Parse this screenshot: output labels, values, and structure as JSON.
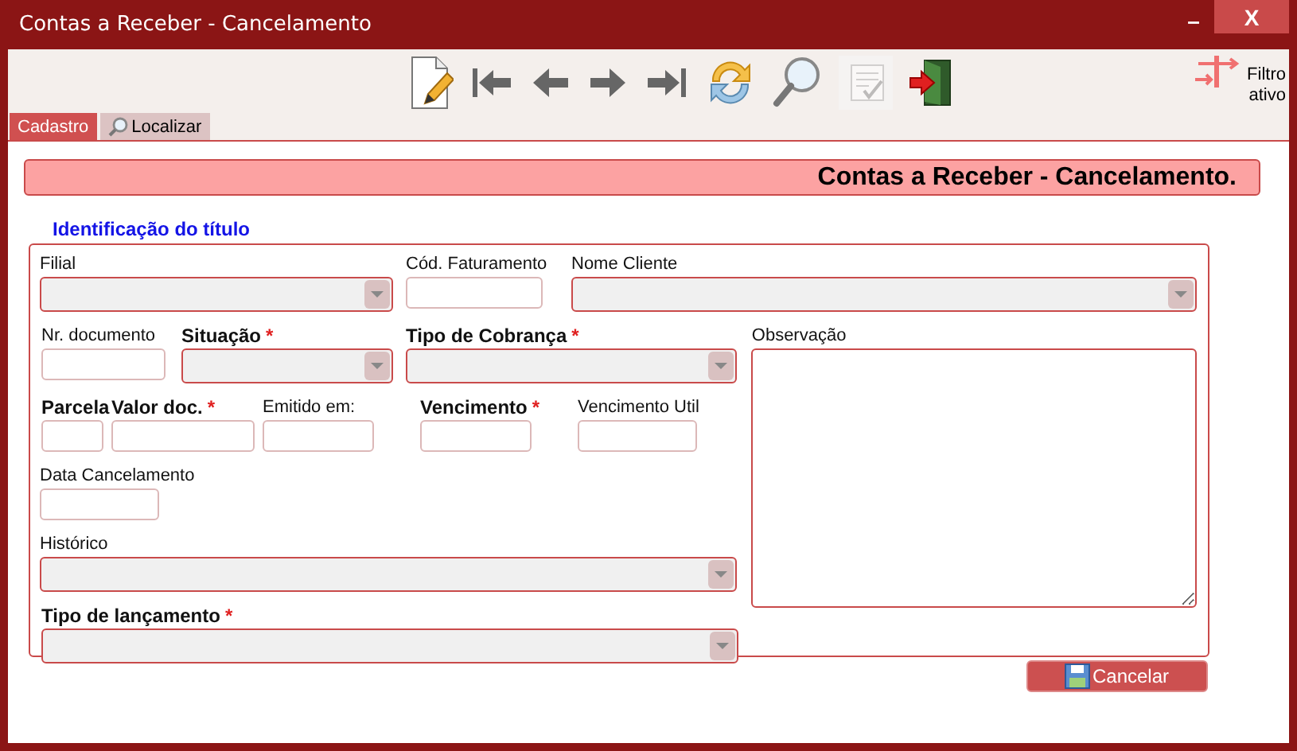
{
  "window": {
    "title": "Contas a Receber - Cancelamento",
    "minimize": "–",
    "close": "X"
  },
  "toolbar": [
    {
      "kind": "new",
      "disabled": false
    },
    {
      "kind": "first",
      "disabled": false
    },
    {
      "kind": "prev",
      "disabled": false
    },
    {
      "kind": "next",
      "disabled": false
    },
    {
      "kind": "last",
      "disabled": false
    },
    {
      "kind": "refresh",
      "disabled": false
    },
    {
      "kind": "search",
      "disabled": false
    },
    {
      "kind": "checklist",
      "disabled": true
    },
    {
      "kind": "exit",
      "disabled": false
    }
  ],
  "filter": {
    "label": "Filtro ativo"
  },
  "tabs": [
    {
      "label": "Cadastro",
      "selected": true,
      "icon": false
    },
    {
      "label": "Localizar",
      "selected": false,
      "icon": true
    }
  ],
  "header": "Contas a Receber - Cancelamento.",
  "section": {
    "legend": "Identificação do título",
    "fields": [
      {
        "label": "Filial",
        "kind": "select",
        "bold": false
      },
      {
        "label": "Cód. Faturamento",
        "kind": "input",
        "bold": false
      },
      {
        "label": "Nome Cliente",
        "kind": "select",
        "bold": false
      },
      {
        "label": "Nr. documento",
        "kind": "input",
        "bold": false
      },
      {
        "label": "Situação",
        "kind": "select",
        "bold": true,
        "mark": "*"
      },
      {
        "label": "Tipo de Cobrança",
        "kind": "select",
        "bold": true,
        "mark": "*"
      },
      {
        "label": "Parcela",
        "kind": "input",
        "bold": true
      },
      {
        "label": "Valor doc.",
        "kind": "input",
        "bold": true,
        "mark": "*"
      },
      {
        "label": "Emitido em:",
        "kind": "input",
        "bold": false
      },
      {
        "label": "Vencimento",
        "kind": "input",
        "bold": true,
        "mark": "*"
      },
      {
        "label": "Vencimento Util",
        "kind": "input",
        "bold": false
      },
      {
        "label": "Data Cancelamento",
        "kind": "input",
        "bold": false
      },
      {
        "label": "Histórico",
        "kind": "select",
        "bold": false
      },
      {
        "label": "Tipo de lançamento",
        "kind": "select",
        "bold": true,
        "mark": "*"
      }
    ],
    "side": {
      "label": "Observação",
      "kind": "textarea",
      "bold": false
    }
  },
  "buttons": [
    {
      "label": "Cancelar"
    }
  ]
}
